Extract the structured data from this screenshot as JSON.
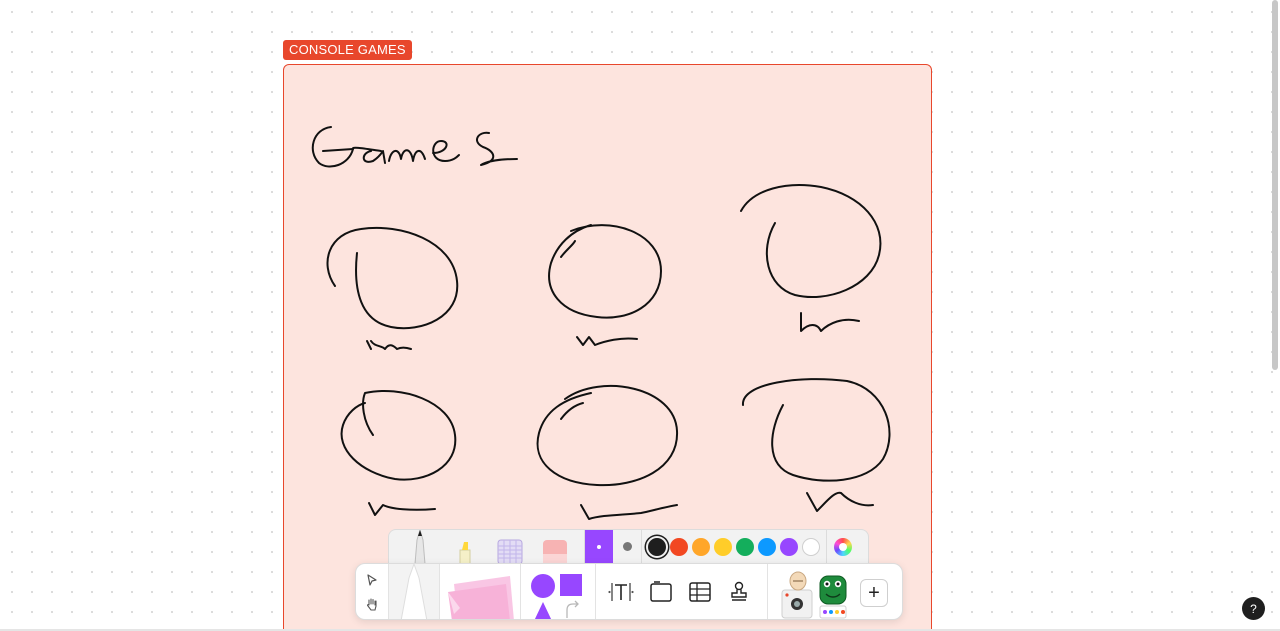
{
  "frame": {
    "label": "CONSOLE GAMES",
    "background_color": "#fde4de",
    "border_color": "#e8472c"
  },
  "canvas": {
    "title_scribble": "Games",
    "sketch_shapes": [
      "circle-with-label",
      "circle-with-label",
      "circle-with-label",
      "circle-with-label",
      "circle-with-label",
      "circle-with-label"
    ]
  },
  "pen_bar": {
    "tools": [
      "pen-icon",
      "highlighter-icon",
      "washi-tape-icon",
      "eraser-icon"
    ],
    "sizes": [
      "small",
      "medium"
    ],
    "selected_size": "small",
    "colors": [
      "#1e1e1e",
      "#f24822",
      "#ffa629",
      "#ffcd29",
      "#14ae5c",
      "#0d99ff",
      "#9747ff",
      "#ffffff"
    ],
    "selected_color": "#1e1e1e",
    "accent": "#9747ff"
  },
  "toolbar": {
    "nav": [
      "cursor-icon",
      "hand-icon"
    ],
    "shapes": [
      "circle",
      "square",
      "triangle",
      "arrow"
    ],
    "actions": [
      "text-icon",
      "section-icon",
      "table-icon",
      "stamp-icon"
    ],
    "plus_label": "+"
  },
  "help": {
    "label": "?"
  }
}
